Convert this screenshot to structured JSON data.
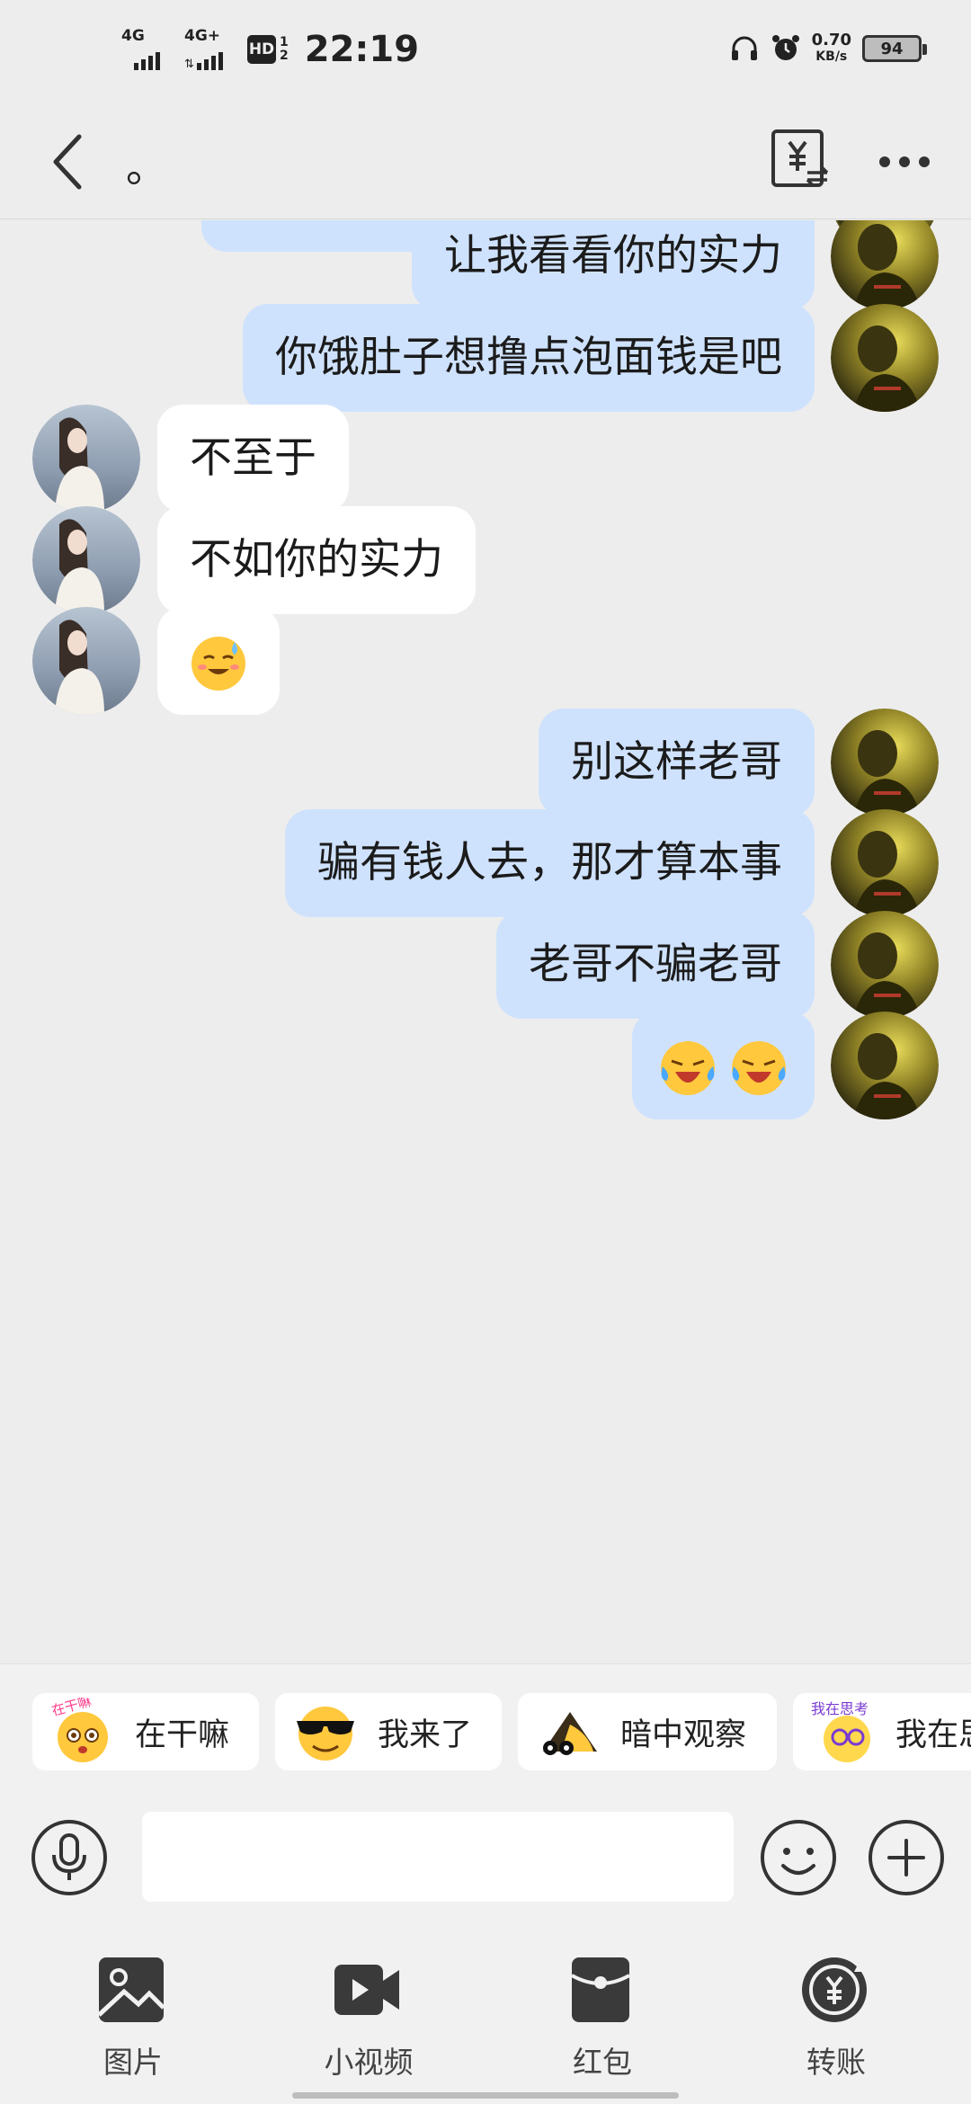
{
  "status_bar": {
    "signal1_label": "4G",
    "signal2_label": "4G+",
    "hd_label": "HD",
    "hd_sim_top": "1",
    "hd_sim_bottom": "2",
    "time": "22:19",
    "net_speed_value": "0.70",
    "net_speed_unit": "KB/s",
    "battery": "94"
  },
  "header": {
    "title": "。"
  },
  "messages": [
    {
      "side": "right",
      "text": "让我看看你的实力"
    },
    {
      "side": "right",
      "text": "你饿肚子想撸点泡面钱是吧"
    },
    {
      "side": "left",
      "text": "不至于"
    },
    {
      "side": "left",
      "text": "不如你的实力"
    },
    {
      "side": "left",
      "emoji": "sweat-smile-emoji"
    },
    {
      "side": "right",
      "text": "别这样老哥"
    },
    {
      "side": "right",
      "text": "骗有钱人去，那才算本事"
    },
    {
      "side": "right",
      "text": "老哥不骗老哥"
    },
    {
      "side": "right",
      "emoji": "crying-laughing-emoji-pair"
    }
  ],
  "quick_replies": [
    {
      "label": "在干嘛",
      "sticker_text": "在干嘛"
    },
    {
      "label": "我来了"
    },
    {
      "label": "暗中观察"
    },
    {
      "label": "我在思考",
      "sticker_text": "我在思考"
    }
  ],
  "input": {
    "value": "",
    "placeholder": ""
  },
  "panel": {
    "items": [
      {
        "label": "图片",
        "icon": "image-icon"
      },
      {
        "label": "小视频",
        "icon": "video-icon"
      },
      {
        "label": "红包",
        "icon": "red-packet-icon"
      },
      {
        "label": "转账",
        "icon": "transfer-icon"
      }
    ]
  },
  "colors": {
    "background": "#ededed",
    "my_bubble": "#cfe2fd",
    "their_bubble": "#ffffff",
    "icon": "#333333"
  }
}
